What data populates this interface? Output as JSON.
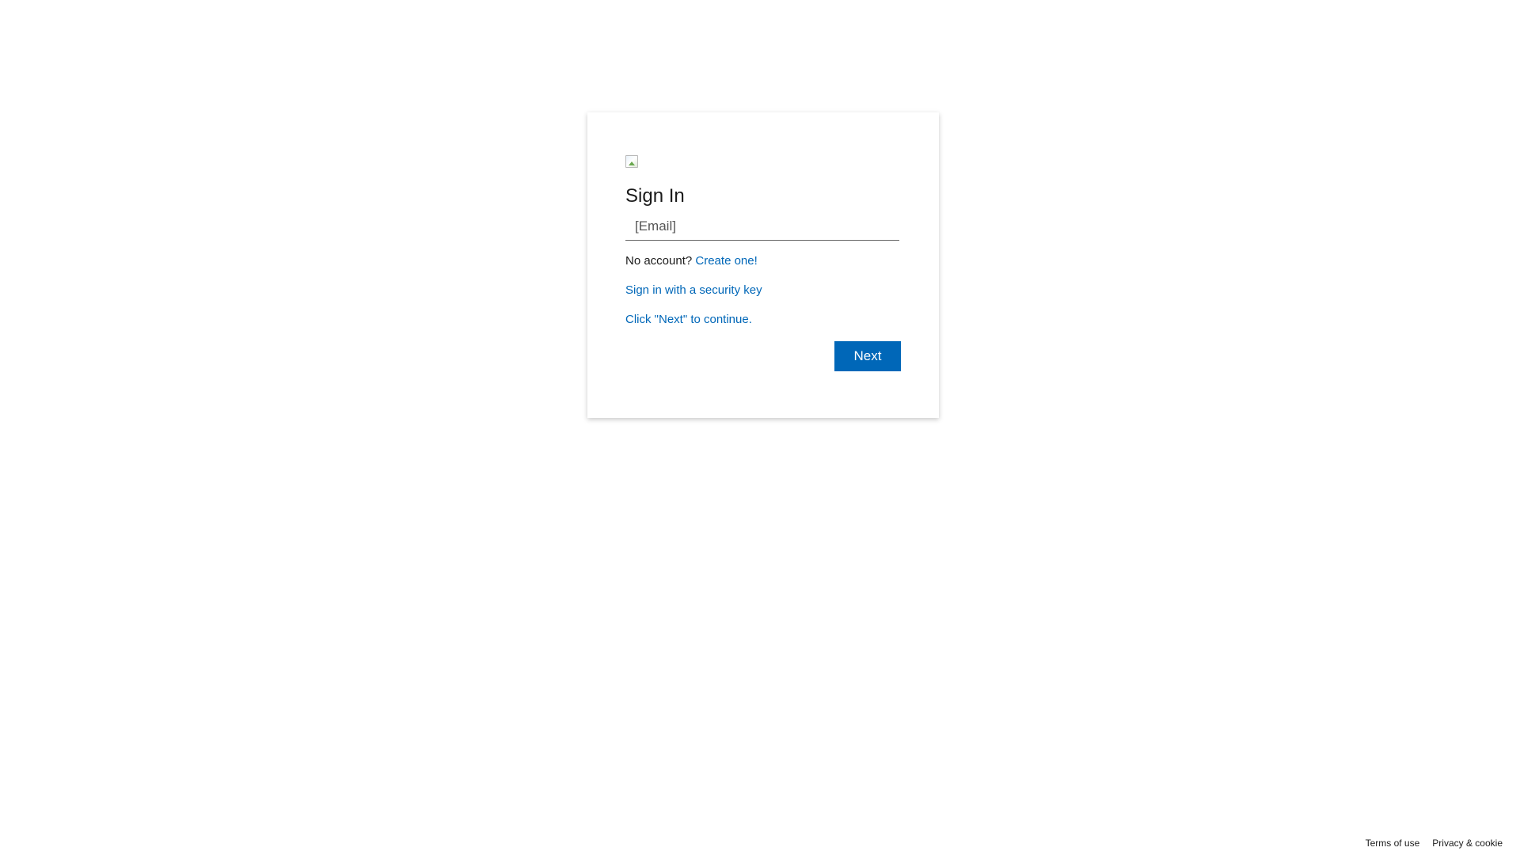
{
  "signin": {
    "title": "Sign In",
    "email_placeholder": "[Email]",
    "email_value": "",
    "no_account_text": "No account? ",
    "create_link": "Create one!",
    "security_key_link": "Sign in with a security key",
    "continue_hint": "Click \"Next\" to continue.",
    "next_button": "Next"
  },
  "footer": {
    "terms": "Terms of use",
    "privacy": "Privacy & cookie"
  },
  "colors": {
    "accent": "#0067b8",
    "text": "#1b1b1b",
    "background": "#ffffff"
  },
  "icons": {
    "logo": "broken-image-icon"
  }
}
